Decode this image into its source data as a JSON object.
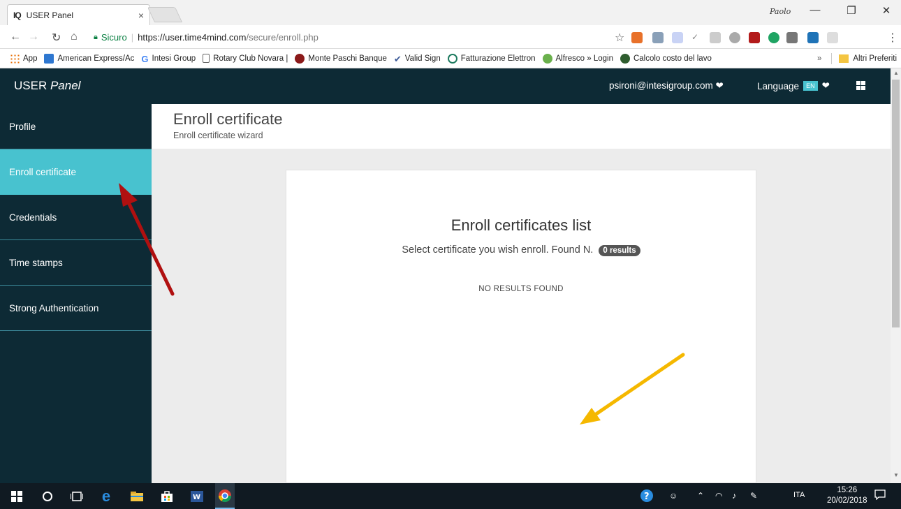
{
  "browser": {
    "tab_title": "USER Panel",
    "tab_favicon": "IQ",
    "tab_close": "×",
    "window_user": "Paolo",
    "win_minimize": "—",
    "win_restore": "❐",
    "win_close": "✕",
    "secure_label": "Sicuro",
    "url_host": "https://user.time4mind.com",
    "url_path": "/secure/enroll.php"
  },
  "bookmarks": [
    {
      "label": "App",
      "color": "#e8710a"
    },
    {
      "label": "American Express/Ac",
      "color": "#2e77d0"
    },
    {
      "label": "Intesi Group",
      "color": "#4285f4"
    },
    {
      "label": "Rotary Club Novara |",
      "color": "#ffffff"
    },
    {
      "label": "Monte Paschi Banque",
      "color": "#8b1a1a"
    },
    {
      "label": "Valid Sign",
      "color": "#3b5998"
    },
    {
      "label": "Fatturazione Elettron",
      "color": "#1d7a5f"
    },
    {
      "label": "Alfresco » Login",
      "color": "#6ab04c"
    },
    {
      "label": "Calcolo costo del lavo",
      "color": "#2f5d2f"
    }
  ],
  "bookmarks_more": "»",
  "bookmarks_other": "Altri Preferiti",
  "header": {
    "brand_main": "USER ",
    "brand_italic": "Panel",
    "user_email": "psironi@intesigroup.com ❤",
    "language_label": "Language",
    "language_code": "EN",
    "language_chevron": "❤"
  },
  "sidebar": {
    "items": [
      {
        "label": "Profile"
      },
      {
        "label": "Enroll certificate"
      },
      {
        "label": "Credentials"
      },
      {
        "label": "Time stamps"
      },
      {
        "label": "Strong Authentication"
      }
    ],
    "active_index": 1
  },
  "page": {
    "title": "Enroll certificate",
    "subtitle": "Enroll certificate wizard"
  },
  "card": {
    "title": "Enroll certificates list",
    "subtitle": "Select certificate you wish enroll. Found N.",
    "count_badge": "0 results",
    "empty_text": "NO RESULTS FOUND"
  },
  "taskbar": {
    "language": "ITA",
    "time": "15:26",
    "date": "20/02/2018"
  },
  "colors": {
    "header_bg": "#0d2a35",
    "accent": "#48c2cf",
    "arrow_red": "#b01010",
    "arrow_yellow": "#f5b800"
  }
}
